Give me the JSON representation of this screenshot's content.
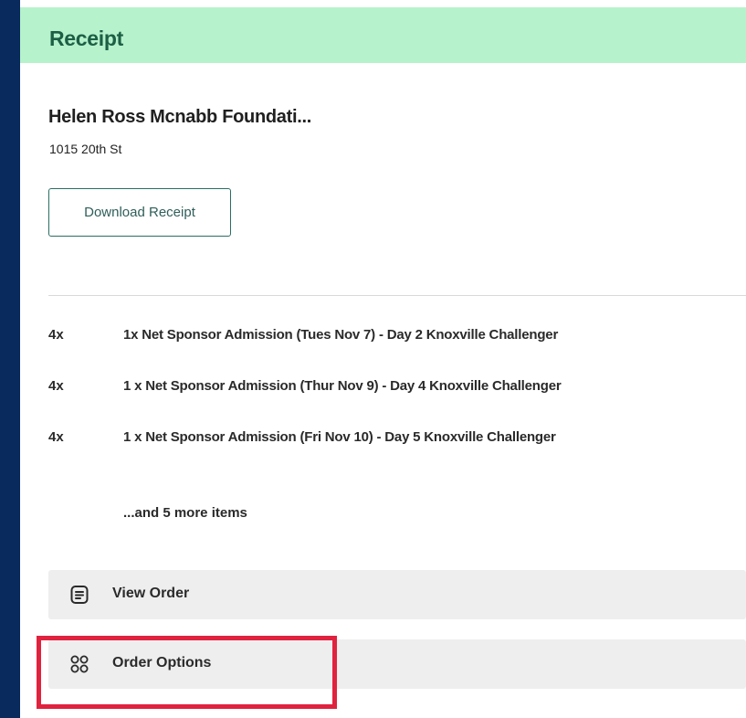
{
  "header": {
    "title": "Receipt"
  },
  "organization": {
    "name": "Helen Ross Mcnabb Foundati...",
    "address": "1015 20th St"
  },
  "actions": {
    "download_receipt": "Download Receipt",
    "view_order": "View Order",
    "order_options": "Order Options"
  },
  "items": [
    {
      "qty": "4x",
      "name": "1x Net Sponsor Admission (Tues Nov 7) - Day 2 Knoxville Challenger"
    },
    {
      "qty": "4x",
      "name": "1 x Net Sponsor Admission (Thur Nov 9) - Day 4 Knoxville Challenger"
    },
    {
      "qty": "4x",
      "name": "1 x Net Sponsor Admission (Fri Nov 10) - Day 5 Knoxville Challenger"
    }
  ],
  "more_items": "...and 5 more items",
  "icons": {
    "view_order": "receipt-list-icon",
    "order_options": "grid-icon"
  },
  "colors": {
    "page_background": "#082a5c",
    "header_background": "#b6f2cc",
    "header_text": "#1c5f45",
    "button_border": "#2c6d63",
    "action_row_background": "#eeeeee",
    "highlight": "#e0223f"
  }
}
